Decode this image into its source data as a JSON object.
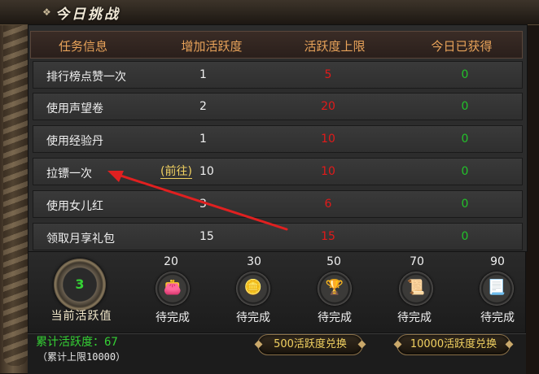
{
  "window": {
    "title": "今日挑战"
  },
  "table": {
    "headers": [
      "任务信息",
      "增加活跃度",
      "活跃度上限",
      "今日已获得"
    ],
    "rows": [
      {
        "name": "排行榜点赞一次",
        "add": "1",
        "limit": "5",
        "today": "0"
      },
      {
        "name": "使用声望卷",
        "add": "2",
        "limit": "20",
        "today": "0"
      },
      {
        "name": "使用经验丹",
        "add": "1",
        "limit": "10",
        "today": "0"
      },
      {
        "name": "拉镖一次",
        "goto": "(前往)",
        "add": "10",
        "limit": "10",
        "today": "0"
      },
      {
        "name": "使用女儿红",
        "add": "3",
        "limit": "6",
        "today": "0"
      },
      {
        "name": "领取月享礼包",
        "add": "15",
        "limit": "15",
        "today": "0"
      }
    ]
  },
  "activity": {
    "current_value": "3",
    "current_label": "当前活跃值",
    "milestones": [
      {
        "value": "20",
        "status": "待完成",
        "icon": "coin-pouch-icon"
      },
      {
        "value": "30",
        "status": "待完成",
        "icon": "gold-coins-icon"
      },
      {
        "value": "50",
        "status": "待完成",
        "icon": "gold-ingot-icon"
      },
      {
        "value": "70",
        "status": "待完成",
        "icon": "scroll-icon"
      },
      {
        "value": "90",
        "status": "待完成",
        "icon": "golden-scroll-icon"
      }
    ]
  },
  "footer": {
    "total": "累计活跃度：67",
    "cap": "（累计上限10000）",
    "exchange_500": "500活跃度兑换",
    "exchange_10000": "10000活跃度兑换"
  },
  "colors": {
    "header_text": "#e8a35a",
    "limit_red": "#e11a1a",
    "today_green": "#22c22a",
    "link_yellow": "#f0d060",
    "arrow_red": "#e02020"
  }
}
